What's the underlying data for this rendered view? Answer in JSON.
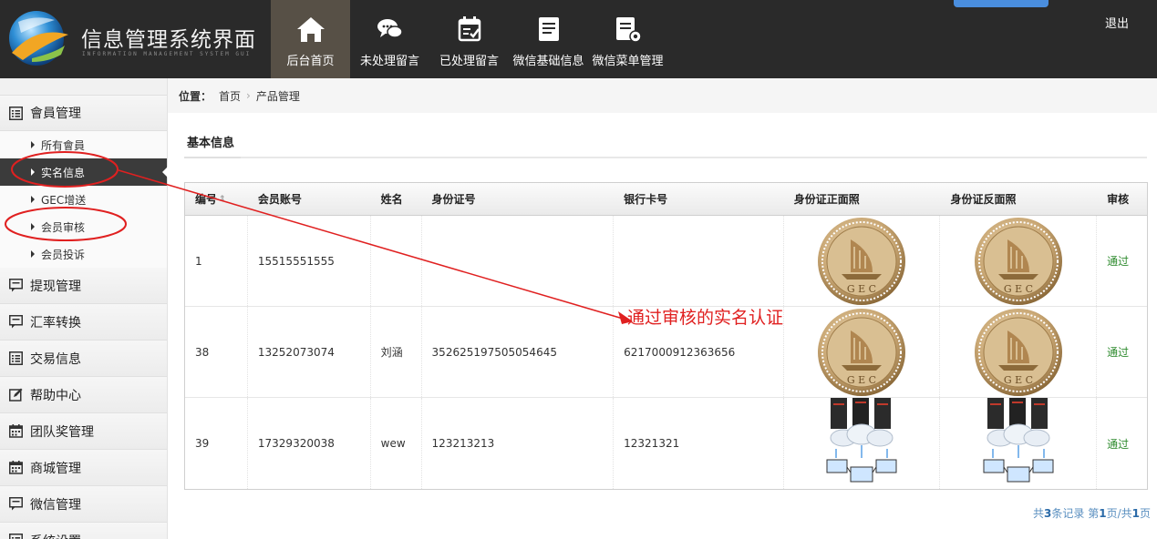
{
  "header": {
    "title": "信息管理系统界面",
    "subtitle": "INFORMATION MANAGEMENT SYSTEM GUI",
    "logout": "退出",
    "nav": [
      {
        "label": "后台首页",
        "icon": "home-icon",
        "active": true
      },
      {
        "label": "未处理留言",
        "icon": "chat-bubbles-icon",
        "active": false
      },
      {
        "label": "已处理留言",
        "icon": "calendar-check-icon",
        "active": false
      },
      {
        "label": "微信基础信息",
        "icon": "document-icon",
        "active": false
      },
      {
        "label": "微信菜单管理",
        "icon": "document-gear-icon",
        "active": false
      }
    ]
  },
  "sidebar": {
    "groups": [
      {
        "label": "會員管理",
        "icon": "list-icon"
      },
      {
        "label": "提现管理",
        "icon": "comment-icon"
      },
      {
        "label": "汇率转换",
        "icon": "comment-icon"
      },
      {
        "label": "交易信息",
        "icon": "list-icon"
      },
      {
        "label": "帮助中心",
        "icon": "edit-icon"
      },
      {
        "label": "团队奖管理",
        "icon": "calendar-icon"
      },
      {
        "label": "商城管理",
        "icon": "calendar-icon"
      },
      {
        "label": "微信管理",
        "icon": "comment-icon"
      },
      {
        "label": "系统设置",
        "icon": "list-icon"
      }
    ],
    "member_items": [
      {
        "label": "所有會員",
        "active": false
      },
      {
        "label": "实名信息",
        "active": true
      },
      {
        "label": "GEC增送",
        "active": false
      },
      {
        "label": "会员审核",
        "active": false
      },
      {
        "label": "会员投诉",
        "active": false
      }
    ]
  },
  "breadcrumb": {
    "prefix": "位置：",
    "items": [
      "首页",
      "产品管理"
    ]
  },
  "tab": {
    "label": "基本信息"
  },
  "table": {
    "headers": [
      "编号",
      "会员账号",
      "姓名",
      "身份证号",
      "银行卡号",
      "身份证正面照",
      "身份证反面照",
      "审核"
    ],
    "sort_icon": "sort-icon",
    "rows": [
      {
        "id": "1",
        "account": "15515551555",
        "name": "",
        "idcard": "",
        "bank": "",
        "front": "gec-coin-image",
        "back": "gec-coin-image",
        "status": "通过"
      },
      {
        "id": "38",
        "account": "13252073074",
        "name": "刘涵",
        "idcard": "352625197505054645",
        "bank": "6217000912363656",
        "front": "gec-coin-image",
        "back": "gec-coin-image",
        "status": "通过"
      },
      {
        "id": "39",
        "account": "17329320038",
        "name": "wew",
        "idcard": "123213213",
        "bank": "12321321",
        "front": "server-cloud-image",
        "back": "server-cloud-image",
        "status": "通过"
      }
    ]
  },
  "pager": {
    "prefix": "共",
    "total": "3",
    "mid": "条记录 第",
    "page": "1",
    "mid2": "页/共",
    "pages": "1",
    "suffix": "页"
  },
  "annotation": {
    "text": "通过审核的实名认证",
    "color": "#e02020"
  }
}
